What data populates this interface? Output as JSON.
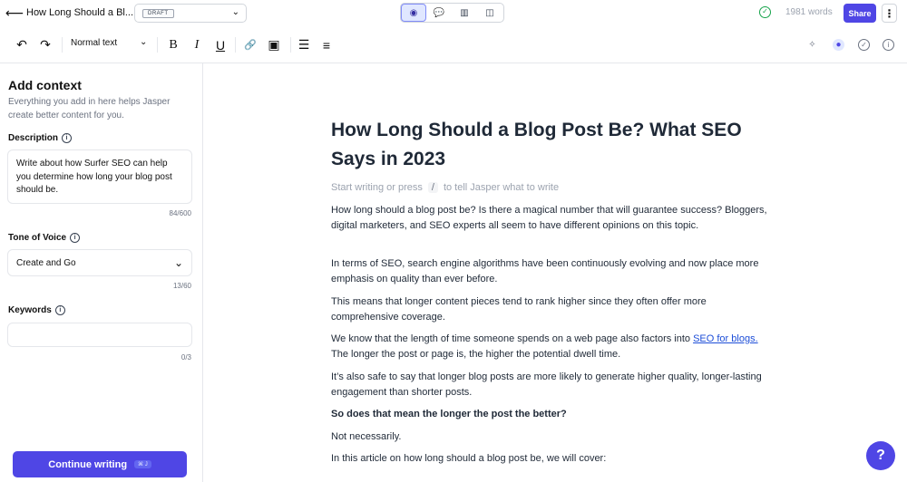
{
  "topbar": {
    "doc_title": "How Long Should a Bl...",
    "status": "DRAFT",
    "word_count": "1981 words",
    "share_label": "Share",
    "more_label": "⋮",
    "view_icons": [
      "eye-icon",
      "chat-icon",
      "stats-icon",
      "sidebar-icon"
    ]
  },
  "toolbar": {
    "undo": "↶",
    "redo": "↷",
    "format": "Normal text",
    "bold": "B",
    "italic": "I",
    "underline": "U",
    "link": "🔗",
    "image": "▣",
    "bullets": "☰",
    "numbered": "≡",
    "right_icons": [
      "sparkle-icon",
      "grammarly-icon",
      "check-icon",
      "info-icon"
    ]
  },
  "sidebar": {
    "title": "Add context",
    "subtitle": "Everything you add in here helps Jasper create better content for you.",
    "description_label": "Description",
    "description_value": "Write about how Surfer SEO can help you determine how long your blog post should be.",
    "description_count": "84/600",
    "tone_label": "Tone of Voice",
    "tone_value": "Create and Go",
    "tone_count": "13/60",
    "keywords_label": "Keywords",
    "keywords_value": "",
    "keywords_count": "0/3",
    "continue_label": "Continue writing",
    "continue_shortcut": "⌘ J"
  },
  "editor": {
    "heading": "How Long Should a Blog Post Be? What SEO Says in 2023",
    "placeholder_start": "Start writing or press",
    "placeholder_slash": "/",
    "placeholder_end": "to tell Jasper what to write",
    "p1": "How long should a blog post be? Is there a magical number that will guarantee success? Bloggers, digital marketers, and SEO experts all seem to have different opinions on this topic.",
    "p2": "In terms of SEO, search engine algorithms have been continuously evolving and now place more emphasis on quality than ever before.",
    "p3": "This means that longer content pieces tend to rank higher since they often offer more comprehensive coverage.",
    "p4_before": "We know that the length of time someone spends on a web page also factors into ",
    "p4_link": "SEO for blogs.",
    "p4_after": " The longer the post or page is, the higher the potential dwell time.",
    "p5": "It’s also safe to say that longer blog posts are more likely to generate higher quality, longer-lasting engagement than shorter posts.",
    "p6": "So does that mean the longer the post the better?",
    "p7": "Not necessarily.",
    "p8": "In this article on how long should a blog post be, we will cover:"
  },
  "help_label": "?"
}
